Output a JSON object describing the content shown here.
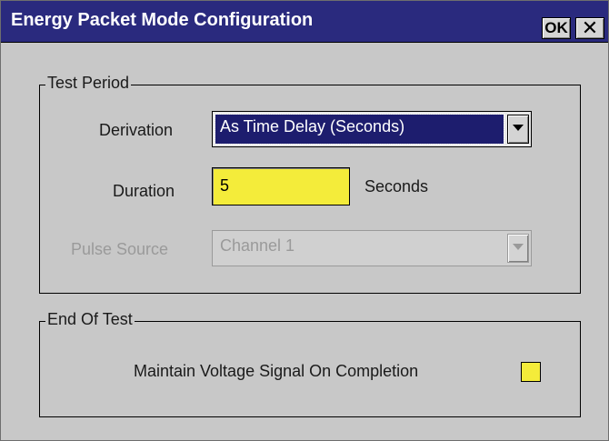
{
  "window": {
    "title": "Energy Packet Mode Configuration",
    "ok_label": "OK",
    "close_label": "✕"
  },
  "test_period": {
    "legend": "Test Period",
    "derivation": {
      "label": "Derivation",
      "value": "As Time Delay (Seconds)"
    },
    "duration": {
      "label": "Duration",
      "value": "5",
      "unit": "Seconds"
    },
    "pulse_source": {
      "label": "Pulse Source",
      "value": "Channel 1",
      "enabled": false
    }
  },
  "end_of_test": {
    "legend": "End Of Test",
    "maintain_voltage": {
      "label": "Maintain Voltage Signal On Completion",
      "checked": false
    }
  },
  "colors": {
    "titlebar": "#2a2a7e",
    "background": "#c8c8c8",
    "input_highlight": "#f4ec3a",
    "selection": "#1d1d6e"
  }
}
